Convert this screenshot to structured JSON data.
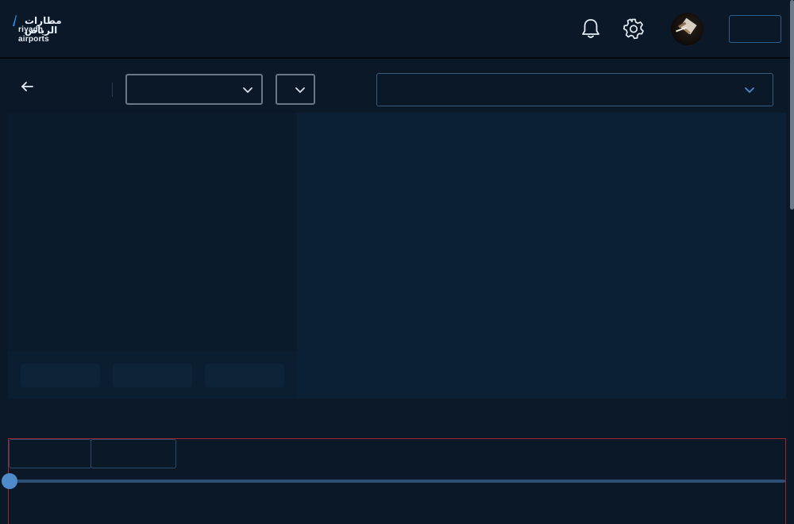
{
  "header": {
    "logo": {
      "arabic": "مطارات الرياض",
      "english": "riyadh airports"
    },
    "icons": {
      "notifications": "bell-icon",
      "settings": "gear-icon"
    },
    "action_label": ""
  },
  "toolbar": {
    "back_icon": "arrow-left-icon",
    "select_a_value": "",
    "select_b_value": "",
    "select_c_value": ""
  },
  "panels": {
    "chips": [
      "",
      "",
      ""
    ]
  },
  "timeline": {
    "tabs": [
      "",
      ""
    ],
    "slider_value": 0
  },
  "colors": {
    "background": "#0b1827",
    "panel": "#0b2035",
    "accent": "#4f8bcb",
    "highlight_border": "#a12430"
  }
}
